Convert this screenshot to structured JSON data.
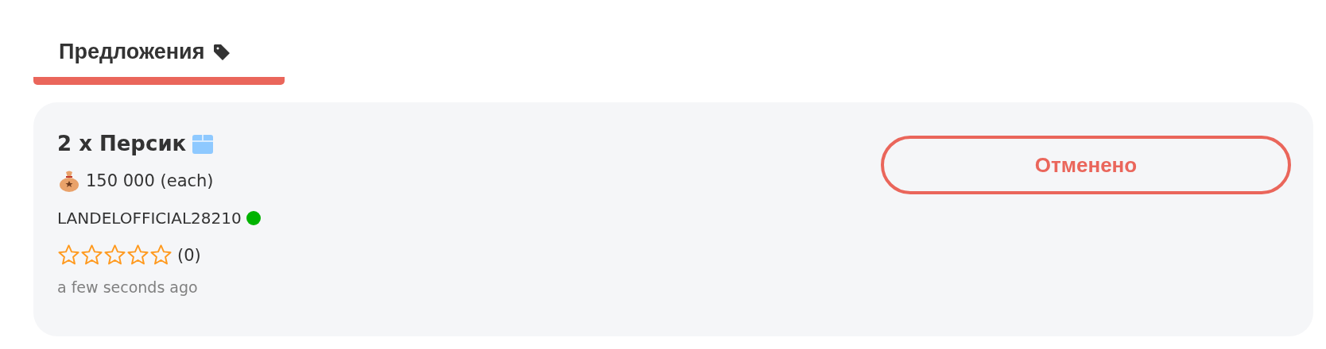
{
  "tabs": [
    {
      "label": "Предложения",
      "selected": true
    }
  ],
  "offers": [
    {
      "quantity": "2 x",
      "item": "Персик",
      "price": "150 000 (each)",
      "seller": "LANDELOFFICIAL28210",
      "color": "#00b300",
      "stars": 0,
      "rating_count": "(0)",
      "time": "a few seconds ago",
      "action": "Отменено"
    }
  ]
}
